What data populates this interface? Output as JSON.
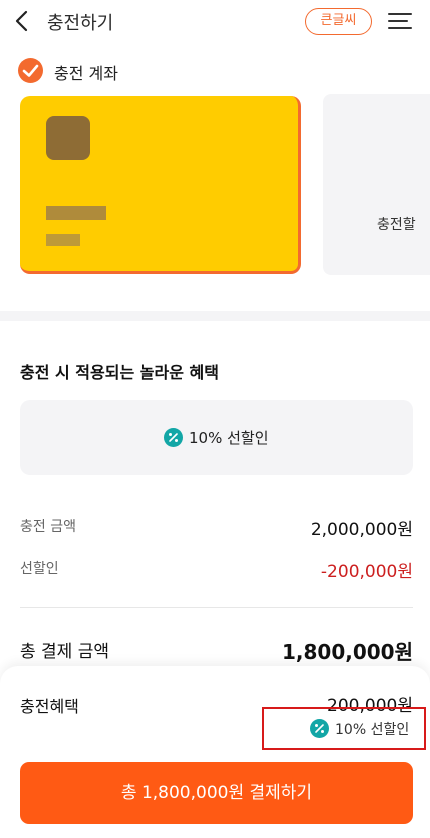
{
  "header": {
    "title": "충전하기",
    "bigfont_label": "큰글씨"
  },
  "account": {
    "checked": true,
    "label": "충전 계좌"
  },
  "cards": {
    "add_card_label": "충전할"
  },
  "benefits": {
    "section_title": "충전 시 적용되는 놀라운 혜택",
    "discount_label": "10% 선할인"
  },
  "summary": {
    "charge_amount_label": "충전 금액",
    "charge_amount_value": "2,000,000원",
    "discount_label": "선할인",
    "discount_value": "-200,000원",
    "total_label": "총 결제 금액",
    "total_value": "1,800,000원"
  },
  "bottom_sheet": {
    "benefit_label": "충전혜택",
    "benefit_value": "200,000원",
    "benefit_discount": "10% 선할인",
    "pay_button_label": "총 1,800,000원 결제하기"
  },
  "colors": {
    "accent": "#f36a2f",
    "card": "#ffcc00",
    "pay_button": "#ff5a14",
    "negative": "#cc1f1f",
    "badge": "#12a6a6"
  }
}
